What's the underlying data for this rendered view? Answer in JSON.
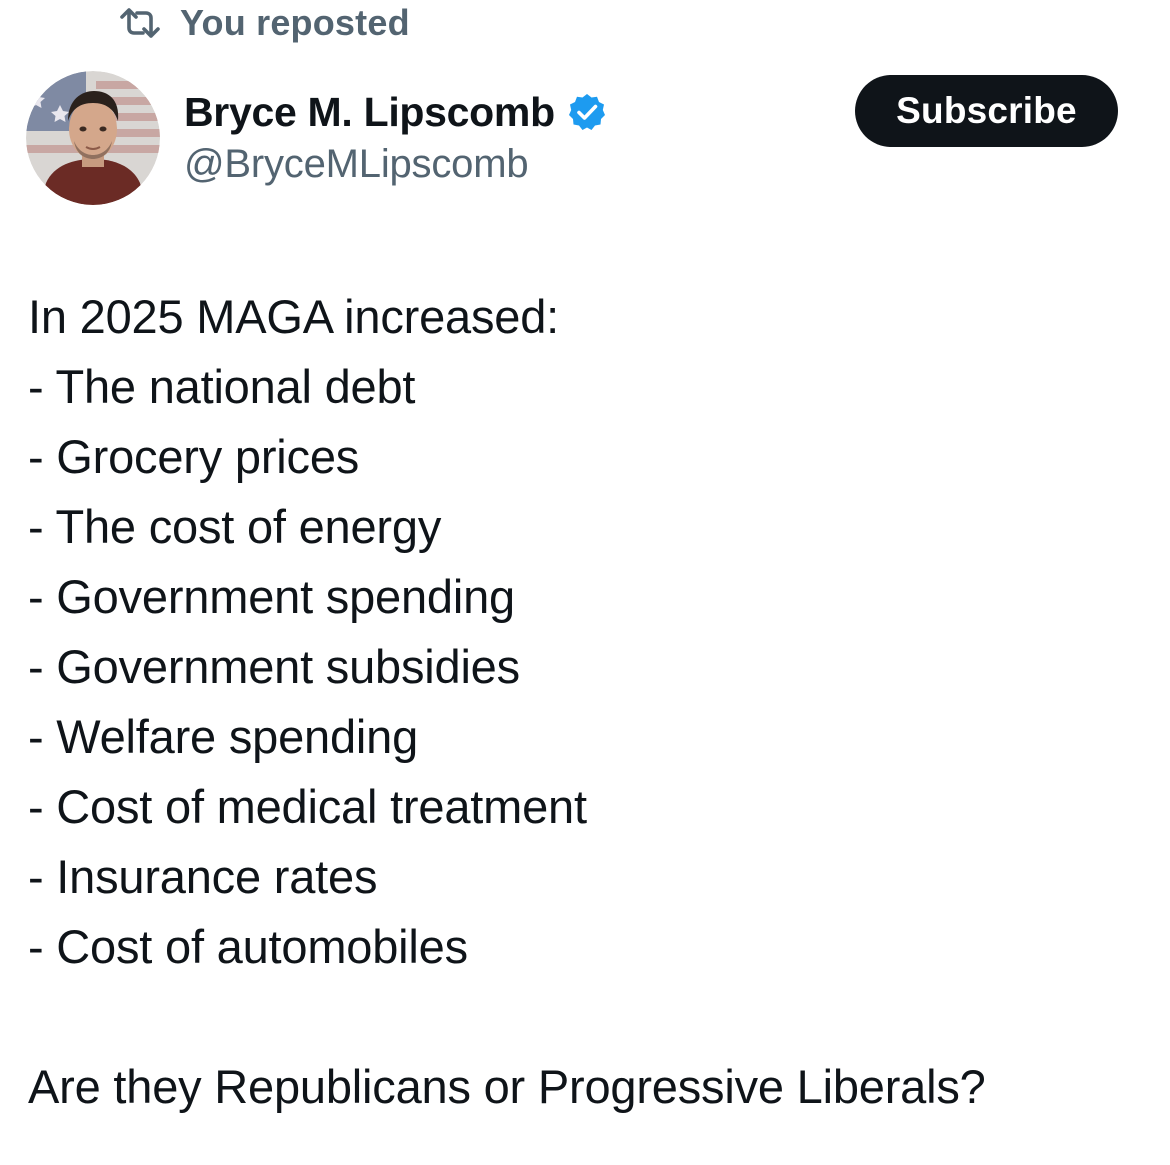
{
  "repost": {
    "icon": "repost-icon",
    "label": "You reposted"
  },
  "author": {
    "avatar": "avatar",
    "name": "Bryce M. Lipscomb",
    "verified_icon": "verified-badge-icon",
    "verified_color": "#1d9bf0",
    "handle": "@BryceMLipscomb"
  },
  "actions": {
    "subscribe_label": "Subscribe"
  },
  "post": {
    "intro": "In 2025 MAGA increased:",
    "items": [
      "- The national debt",
      "- Grocery prices",
      "- The cost of energy",
      "- Government spending",
      "- Government subsidies",
      "- Welfare spending",
      "- Cost of medical treatment",
      "- Insurance rates",
      "- Cost of automobiles"
    ],
    "closing": "Are they Republicans or Progressive Liberals?"
  },
  "colors": {
    "text": "#0f1419",
    "secondary": "#536471",
    "button_bg": "#0f1419",
    "button_text": "#ffffff"
  }
}
